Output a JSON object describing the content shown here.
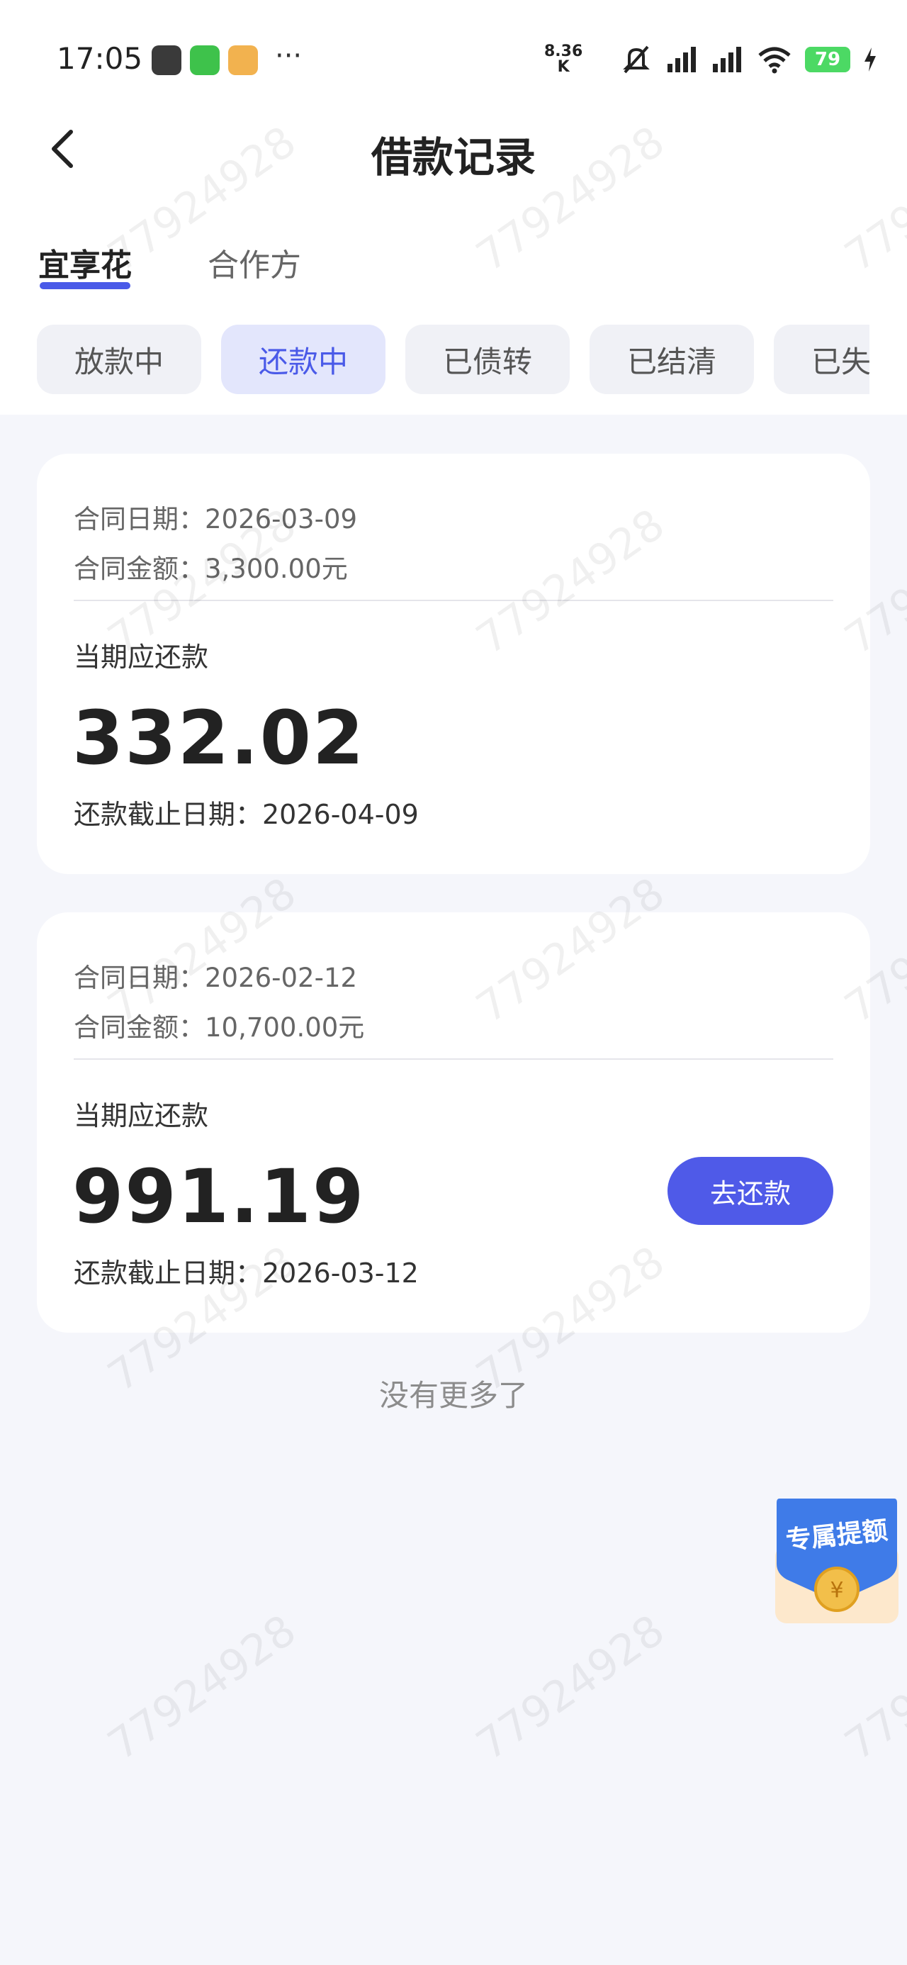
{
  "status_bar": {
    "time": "17:05",
    "net_speed_value": "8.36",
    "net_speed_unit": "K",
    "battery": "79",
    "more": "···"
  },
  "header": {
    "title": "借款记录"
  },
  "main_tabs": [
    {
      "label": "宜享花",
      "active": true
    },
    {
      "label": "合作方",
      "active": false
    }
  ],
  "status_chips": [
    {
      "label": "放款中",
      "active": false
    },
    {
      "label": "还款中",
      "active": true
    },
    {
      "label": "已债转",
      "active": false
    },
    {
      "label": "已结清",
      "active": false
    },
    {
      "label": "已失效",
      "active": false
    }
  ],
  "loans": [
    {
      "contract_date": "合同日期：2026-03-09",
      "contract_amount": "合同金额：3,300.00元",
      "due_label": "当期应还款",
      "due_amount": "332.02",
      "deadline": "还款截止日期：2026-04-09"
    },
    {
      "contract_date": "合同日期：2026-02-12",
      "contract_amount": "合同金额：10,700.00元",
      "due_label": "当期应还款",
      "due_amount": "991.19",
      "deadline": "还款截止日期：2026-03-12",
      "action_label": "去还款"
    }
  ],
  "footer": {
    "no_more": "没有更多了"
  },
  "promo": {
    "label": "专属提额"
  },
  "watermark": "77924928",
  "colors": {
    "accent": "#4f5ae8",
    "chip_active_bg": "#e3e6fc",
    "background": "#f5f6fb"
  }
}
